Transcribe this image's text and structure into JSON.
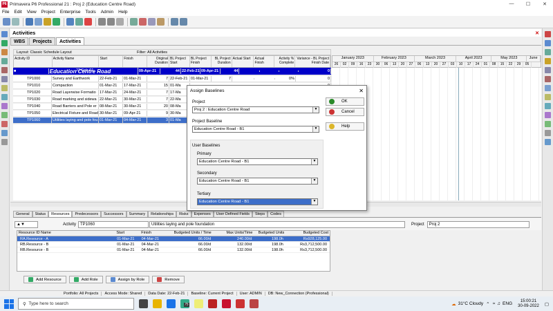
{
  "window": {
    "logo": "P6",
    "title": "Primavera P6 Professional 21 : Proj 2 (Education Centre Road)",
    "min": "—",
    "max": "☐",
    "close": "✕"
  },
  "menu": [
    "File",
    "Edit",
    "View",
    "Project",
    "Enterprise",
    "Tools",
    "Admin",
    "Help"
  ],
  "panel": {
    "title": "Activities",
    "close": "✕"
  },
  "tabs": [
    "WBS",
    "Projects",
    "Activities"
  ],
  "layout_label": "Layout: Classic Schedule Layout",
  "filter_label": "Filter: All Activities",
  "columns": [
    "Activity ID",
    "Activity Name",
    "Start",
    "Finish",
    "Original Duration",
    "BL Project Start",
    "BL Project Finish",
    "BL Project Duration",
    "Actual Start",
    "Actual Finish",
    "Activity % Complete",
    "Variance - BL Project Finish Date"
  ],
  "wbs_row": {
    "id": "",
    "name": "Education Centre Road",
    "start": "22-Feb-21",
    "finish": "09-Apr-21",
    "dur": "44",
    "bls": "22-Feb-21",
    "blf": "09-Apr-21",
    "bld": "44",
    "as": "",
    "af": "",
    "pct": "",
    "var": "0"
  },
  "activities": [
    {
      "id": "TP1000",
      "name": "Survey and Earthwork",
      "start": "22-Feb-21",
      "finish": "01-Mar-21",
      "dur": "7",
      "bls": "22-Feb-21",
      "blf": "01-Mar-21",
      "bld": "7",
      "as": "",
      "af": "",
      "pct": "0%",
      "var": "0"
    },
    {
      "id": "TP1010",
      "name": "Compaction",
      "start": "01-Mar-21",
      "finish": "17-Mar-21",
      "dur": "15",
      "bls": "01-Ma",
      "blf": "",
      "bld": "",
      "as": "",
      "af": "",
      "pct": "",
      "var": "0"
    },
    {
      "id": "TP1020",
      "name": "Road Layerwise Formatio",
      "start": "17-Mar-21",
      "finish": "24-Mar-21",
      "dur": "7",
      "bls": "17-Ma",
      "blf": "",
      "bld": "",
      "as": "",
      "af": "",
      "pct": "",
      "var": "0"
    },
    {
      "id": "TP1030",
      "name": "Road marking and sidewa",
      "start": "22-Mar-21",
      "finish": "30-Mar-21",
      "dur": "7",
      "bls": "22-Ma",
      "blf": "",
      "bld": "",
      "as": "",
      "af": "",
      "pct": "",
      "var": "0"
    },
    {
      "id": "TP1040",
      "name": "Road Barriers and Pole er",
      "start": "08-Mar-21",
      "finish": "30-Mar-21",
      "dur": "20",
      "bls": "08-Ma",
      "blf": "",
      "bld": "",
      "as": "",
      "af": "",
      "pct": "",
      "var": "0"
    },
    {
      "id": "TP1050",
      "name": "Electrical Fixture and Road",
      "start": "30-Mar-21",
      "finish": "09-Apr-21",
      "dur": "9",
      "bls": "30-Ma",
      "blf": "",
      "bld": "",
      "as": "",
      "af": "",
      "pct": "",
      "var": "0"
    },
    {
      "id": "TP1060",
      "name": "Utilities laying and pole fou",
      "start": "01-Mar-21",
      "finish": "04-Mar-21",
      "dur": "3",
      "bls": "01-Ma",
      "blf": "",
      "bld": "",
      "as": "",
      "af": "",
      "pct": "",
      "var": "0"
    }
  ],
  "gantt": {
    "months": [
      "January 2023",
      "February 2023",
      "March 2023",
      "April 2023",
      "May 2023",
      "June"
    ],
    "days": [
      "26",
      "02",
      "09",
      "16",
      "23",
      "30",
      "06",
      "13",
      "20",
      "27",
      "06",
      "13",
      "20",
      "27",
      "03",
      "10",
      "17",
      "24",
      "01",
      "08",
      "15",
      "22",
      "29",
      "05"
    ]
  },
  "bottom_tabs": [
    "General",
    "Status",
    "Resources",
    "Predecessors",
    "Successors",
    "Summary",
    "Relationships",
    "Risks",
    "Expenses",
    "User Defined Fields",
    "Steps",
    "Codes"
  ],
  "activity_detail": {
    "label": "Activity",
    "id": "TP1060",
    "name": "Utilities laying and pole foundation",
    "project_label": "Project",
    "project": "Proj 2"
  },
  "resource_columns": [
    "Resource ID Name",
    "Start",
    "Finish",
    "Budgeted Units / Time",
    "Max Units/Time",
    "Budgeted Units",
    "Budgeted Cost"
  ],
  "resources": [
    {
      "name": "RA.Resource - A",
      "start": "01-Mar-21",
      "finish": "04-Mar-21",
      "but": "66.00/d",
      "max": "240.00/d",
      "bu": "198.0h",
      "cost": "Rs928,125.00"
    },
    {
      "name": "RB.Resource - B",
      "start": "01-Mar-21",
      "finish": "04-Mar-21",
      "but": "66.00/d",
      "max": "132.00/d",
      "bu": "198.0h",
      "cost": "Rs3,712,500.00"
    },
    {
      "name": "RB.Resource - B",
      "start": "01-Mar-21",
      "finish": "04-Mar-21",
      "but": "66.00/d",
      "max": "132.00/d",
      "bu": "198.0h",
      "cost": "Rs3,712,500.00"
    }
  ],
  "bottom_buttons": [
    "Add Resource",
    "Add Role",
    "Assign by Role",
    "Remove"
  ],
  "status": [
    "Portfolio: All Projects",
    "Access Mode: Shared",
    "Data Date: 22-Feb-21",
    "Baseline: Current Project",
    "User: ADMIN",
    "DB: New_Connection (Professional)"
  ],
  "dialog": {
    "title": "Assign Baselines",
    "close": "✕",
    "project_label": "Project",
    "project_value": "Proj 2 : Education Centre Road",
    "baseline_label": "Project Baseline",
    "baseline_value": "Education Centre Road - B1",
    "user_label": "User Baselines",
    "primary_label": "Primary",
    "primary_value": "Education Centre Road - B1",
    "secondary_label": "Secondary",
    "secondary_value": "Education Centre Road - B1",
    "tertiary_label": "Tertiary",
    "tertiary_value": "Education Centre Road - B1",
    "ok": "OK",
    "cancel": "Cancel",
    "help": "Help"
  },
  "taskbar": {
    "search": "Type here to search",
    "weather": "31°C  Cloudy",
    "lang": "ENG",
    "time": "15:00:21",
    "date": "30-09-2022",
    "badge": "75"
  }
}
